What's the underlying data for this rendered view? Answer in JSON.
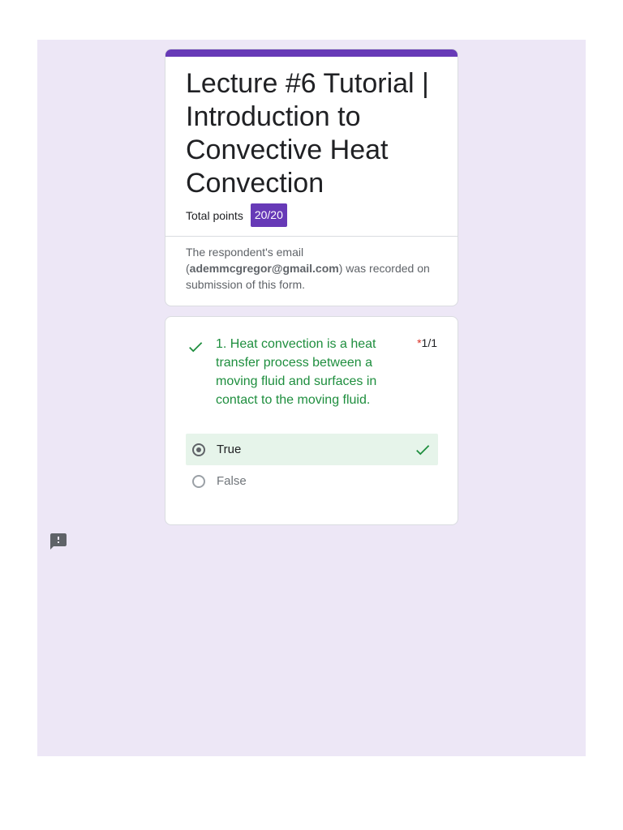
{
  "form": {
    "title": "Lecture #6 Tutorial | Introduction to Convective Heat Convection",
    "total_points_label": "Total points",
    "total_points_value": "20/20",
    "email_prefix": "The respondent's email (",
    "email": "ademmcgregor@gmail.com",
    "email_suffix": ") was recorded on submission of this form."
  },
  "question": {
    "text": "1. Heat convection is a heat transfer process between a moving fluid and surfaces in contact to the moving fluid.",
    "required_mark": "*",
    "score": "1/1",
    "options": [
      {
        "label": "True",
        "selected": true,
        "correct": true
      },
      {
        "label": "False",
        "selected": false,
        "correct": false
      }
    ]
  },
  "colors": {
    "accent": "#673ab7",
    "page_background": "#ede7f6",
    "correct_green": "#1e8e3e",
    "correct_bg": "#e6f4ea"
  },
  "icons": {
    "question_status": "check-icon",
    "correct_option": "check-icon",
    "feedback": "report-feedback-icon"
  }
}
